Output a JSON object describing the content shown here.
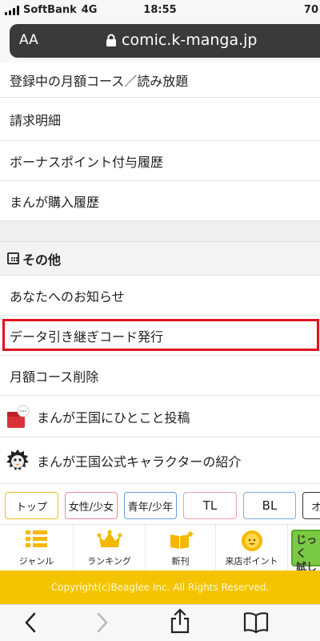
{
  "status": {
    "carrier": "SoftBank",
    "network": "4G",
    "time": "18:55",
    "battery": "70"
  },
  "browser": {
    "text_size": "AA",
    "url": "comic.k-manga.jp"
  },
  "menu": {
    "items_top": [
      "登録中の月額コース／読み放題",
      "請求明細",
      "ボーナスポイント付与履歴",
      "まんが購入履歴"
    ],
    "section_title": "その他",
    "items_other": [
      "あなたへのお知らせ",
      "データ引き継ぎコード発行",
      "月額コース削除",
      "まんが王国にひとこと投稿",
      "まんが王国公式キャラクターの紹介"
    ]
  },
  "tabs": [
    {
      "label": "トップ",
      "color": "#e8c020"
    },
    {
      "label": "女性/少女",
      "color": "#e88a9a"
    },
    {
      "label": "青年/少年",
      "color": "#6a9ae0"
    },
    {
      "label": "TL",
      "color": "#e8a0b0"
    },
    {
      "label": "BL",
      "color": "#7ab0e0"
    },
    {
      "label": "オ",
      "color": "#333333"
    }
  ],
  "bottom_nav": [
    {
      "label": "ジャンル",
      "icon": "list-icon"
    },
    {
      "label": "ランキング",
      "icon": "crown-icon"
    },
    {
      "label": "新刊",
      "icon": "new-book-icon"
    },
    {
      "label": "来店ポイント",
      "icon": "sun-character-icon"
    }
  ],
  "promo_badge": {
    "line1": "じっく",
    "line2": "試し"
  },
  "footer": {
    "copyright": "Copyright(c)Beaglee Inc. All Rights Reserved."
  },
  "colors": {
    "highlight": "#e01020",
    "footer": "#f5c400",
    "accent": "#f5b800"
  }
}
